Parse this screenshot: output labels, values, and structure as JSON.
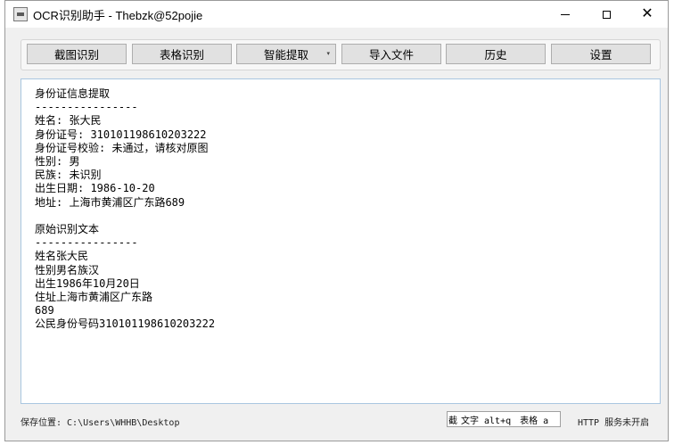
{
  "window": {
    "title": "OCR识别助手 - Thebzk@52pojie",
    "controls": {
      "minimize": "minimize-icon",
      "maximize": "maximize-icon",
      "close": "✕"
    }
  },
  "toolbar": {
    "buttons": [
      {
        "label": "截图识别"
      },
      {
        "label": "表格识别"
      },
      {
        "label": "智能提取",
        "dropdown": "▾"
      },
      {
        "label": "导入文件"
      },
      {
        "label": "历史"
      },
      {
        "label": "设置"
      }
    ]
  },
  "content": {
    "lines": [
      "身份证信息提取",
      "----------------",
      "姓名: 张大民",
      "身份证号: 310101198610203222",
      "身份证号校验: 未通过，请核对原图",
      "性别: 男",
      "民族: 未识别",
      "出生日期: 1986-10-20",
      "地址: 上海市黄浦区广东路689",
      "",
      "原始识别文本",
      "----------------",
      "姓名张大民",
      "性别男名族汉",
      "出生1986年10月20日",
      "住址上海市黄浦区广东路",
      "689",
      "公民身份号码310101198610203222"
    ]
  },
  "status": {
    "save_location": "保存位置: C:\\Users\\WHHB\\Desktop",
    "hotkey_cut": "截",
    "hotkey_text": "文字 alt+q",
    "hotkey_table": "表格 a",
    "http_service": "HTTP 服务未开启"
  }
}
